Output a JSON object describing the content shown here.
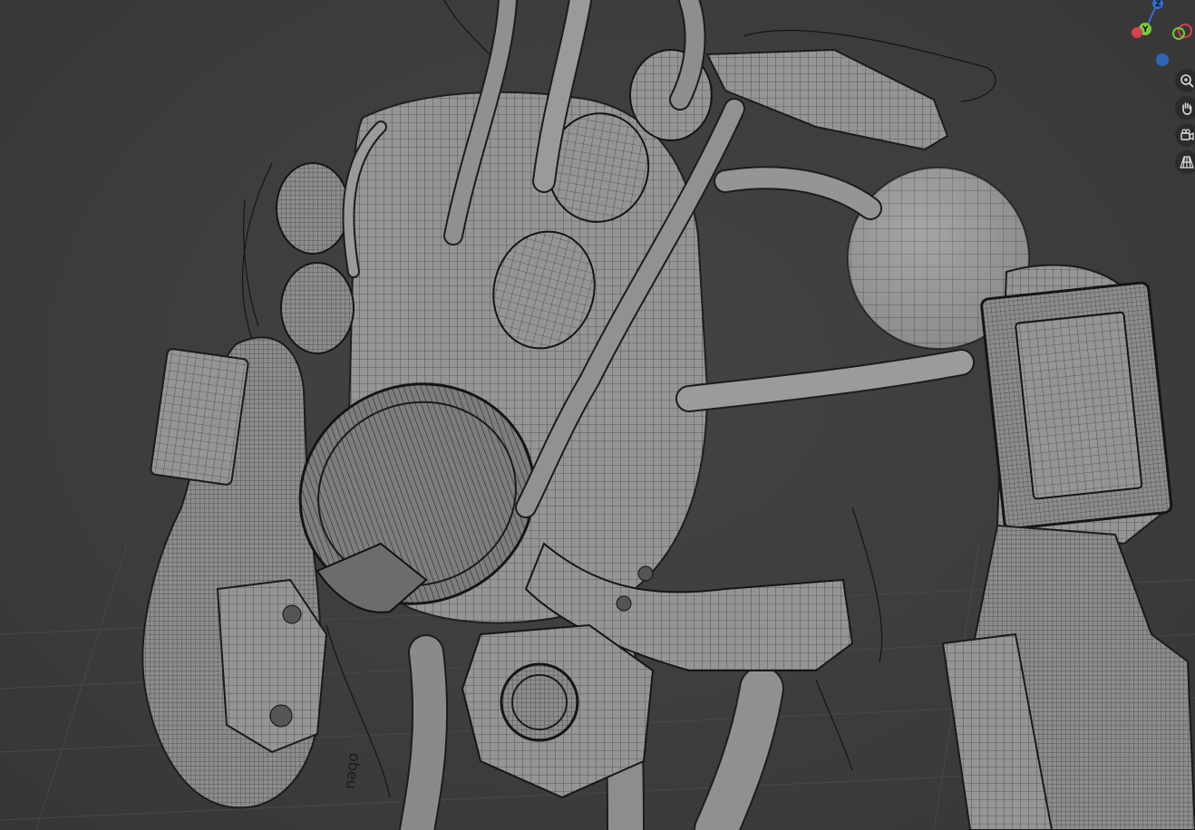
{
  "viewport": {
    "background": "#3d3d3d",
    "grid_color": "#4a4a4a",
    "mesh_fill": "#8f8f8f",
    "mesh_wire": "#222222",
    "annotation_stroke": "#151515"
  },
  "gizmo": {
    "axes": [
      {
        "label": "Z",
        "color": "#2f6fd6"
      },
      {
        "label": "Y",
        "color": "#7cc53a"
      },
      {
        "label": "X",
        "color": "#d8404f"
      }
    ]
  },
  "nav_tools": [
    {
      "name": "zoom-icon"
    },
    {
      "name": "hand-pan-icon"
    },
    {
      "name": "camera-view-icon"
    },
    {
      "name": "perspective-grid-icon"
    }
  ],
  "model_text": {
    "engraving": "obeu"
  }
}
